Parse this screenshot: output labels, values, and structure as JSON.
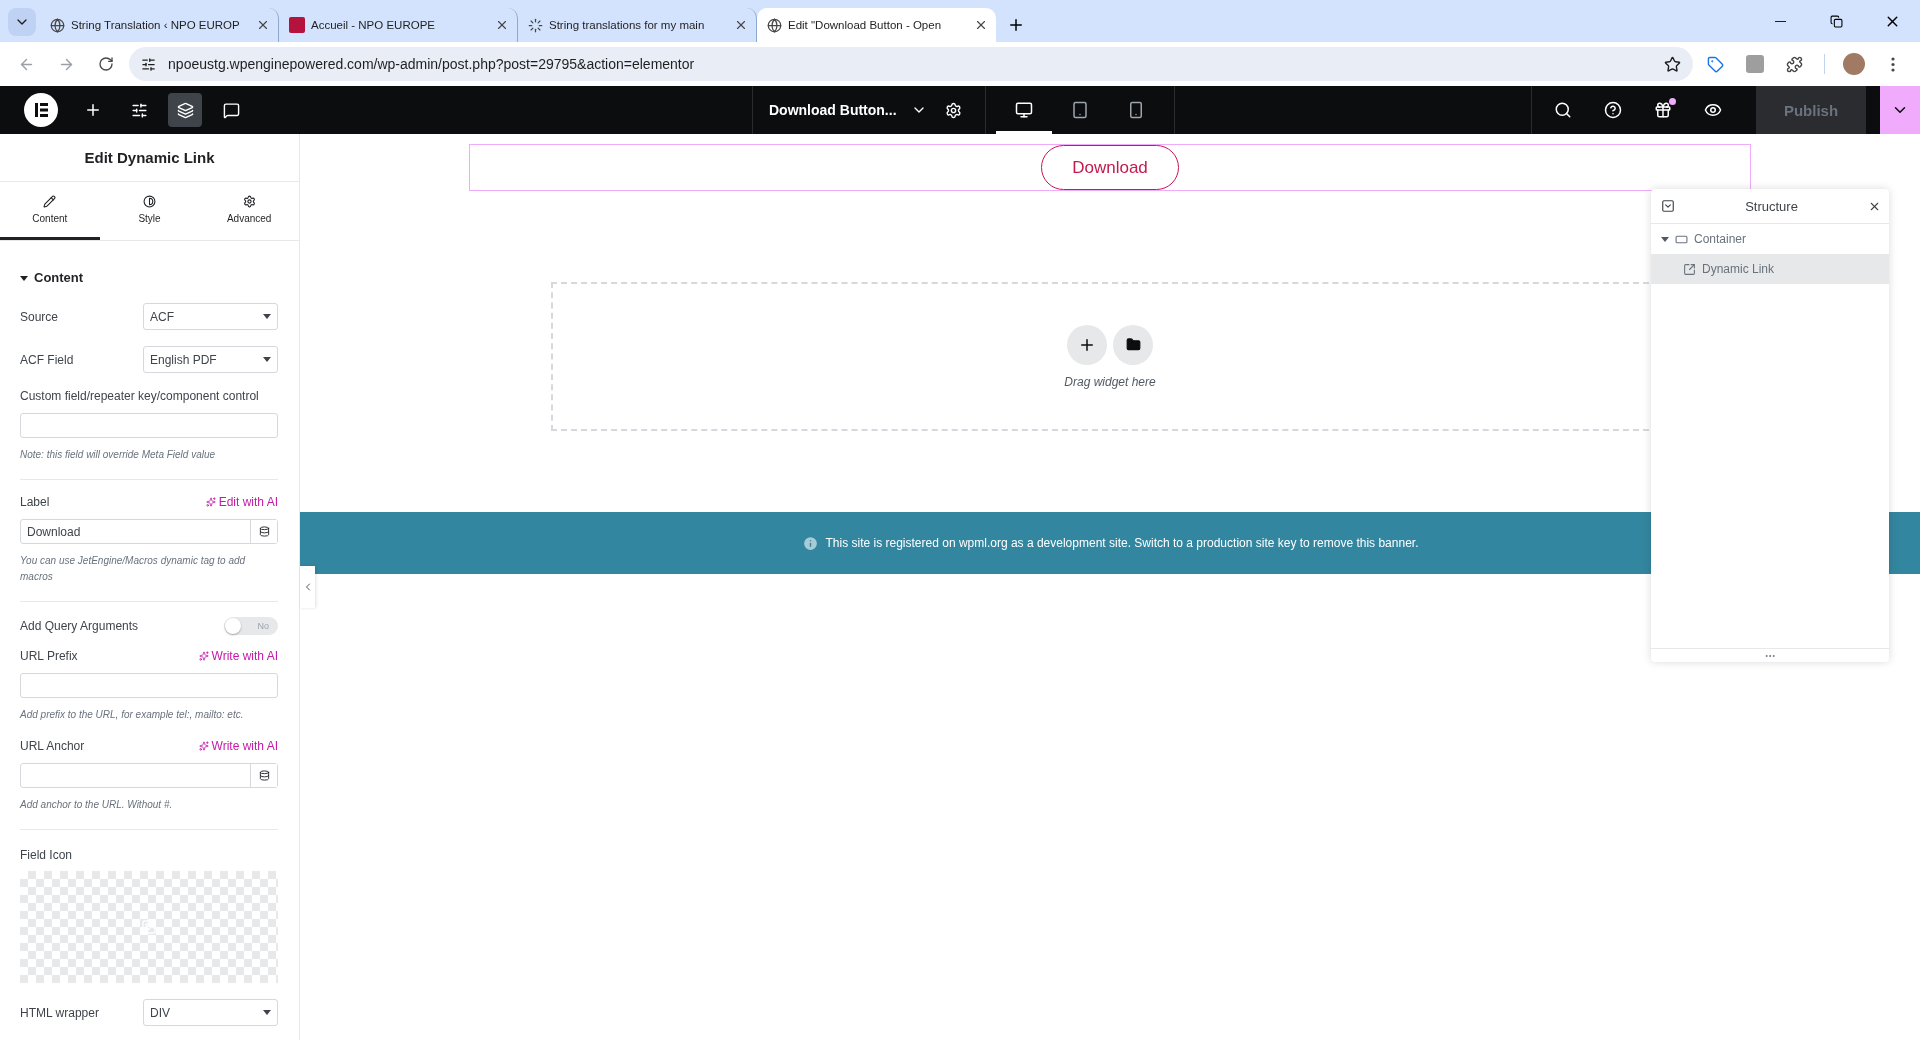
{
  "browser": {
    "tabs": [
      {
        "title": "String Translation ‹ NPO EUROP",
        "selected": false
      },
      {
        "title": "Accueil - NPO EUROPE",
        "selected": false
      },
      {
        "title": "String translations for my main",
        "selected": false
      },
      {
        "title": "Edit \"Download Button - Open",
        "selected": true
      }
    ],
    "url": "npoeustg.wpenginepowered.com/wp-admin/post.php?post=29795&action=elementor"
  },
  "editor": {
    "document_title": "Download Button...",
    "devices": [
      {
        "kind": "desktop",
        "selected": true
      },
      {
        "kind": "tablet",
        "selected": false
      },
      {
        "kind": "mobile",
        "selected": false
      }
    ],
    "gift_badge": true,
    "publish": {
      "label": "Publish",
      "disabled": true
    }
  },
  "panel": {
    "title": "Edit Dynamic Link",
    "tabs": [
      {
        "label": "Content",
        "selected": true
      },
      {
        "label": "Style",
        "selected": false
      },
      {
        "label": "Advanced",
        "selected": false
      }
    ],
    "section": {
      "title": "Content",
      "expanded": true
    },
    "controls": [
      {
        "kind": "select",
        "label": "Source",
        "value": "ACF"
      },
      {
        "kind": "select",
        "label": "ACF Field",
        "value": "English PDF"
      },
      {
        "kind": "text",
        "label": "Custom field/repeater key/component control",
        "dynamic": false,
        "note": "Note: this field will override Meta Field value"
      },
      {
        "kind": "divider"
      },
      {
        "kind": "text",
        "label": "Label",
        "ai_action": "Edit with AI",
        "value": "Download",
        "dynamic": true,
        "note": "You can use JetEngine/Macros dynamic tag to add macros"
      },
      {
        "kind": "divider"
      },
      {
        "kind": "switch",
        "label": "Add Query Arguments",
        "on": false,
        "state_text": "No"
      },
      {
        "kind": "text",
        "label": "URL Prefix",
        "ai_action": "Write with AI",
        "dynamic": false,
        "note": "Add prefix to the URL, for example tel:, mailto: etc."
      },
      {
        "kind": "text",
        "label": "URL Anchor",
        "ai_action": "Write with AI",
        "dynamic": true,
        "note": "Add anchor to the URL. Without #."
      },
      {
        "kind": "divider"
      },
      {
        "kind": "media",
        "label": "Field Icon"
      },
      {
        "kind": "select",
        "label": "HTML wrapper",
        "value": "DIV"
      }
    ]
  },
  "canvas": {
    "button_label": "Download",
    "drop_hint": "Drag widget here",
    "banner": "This site is registered on wpml.org as a development site. Switch to a production site key to remove this banner."
  },
  "structure": {
    "title": "Structure",
    "tree": [
      {
        "label": "Container",
        "kind": "container",
        "expanded": true,
        "selected": false,
        "children": [
          {
            "label": "Dynamic Link",
            "kind": "widget",
            "selected": true
          }
        ]
      }
    ]
  }
}
